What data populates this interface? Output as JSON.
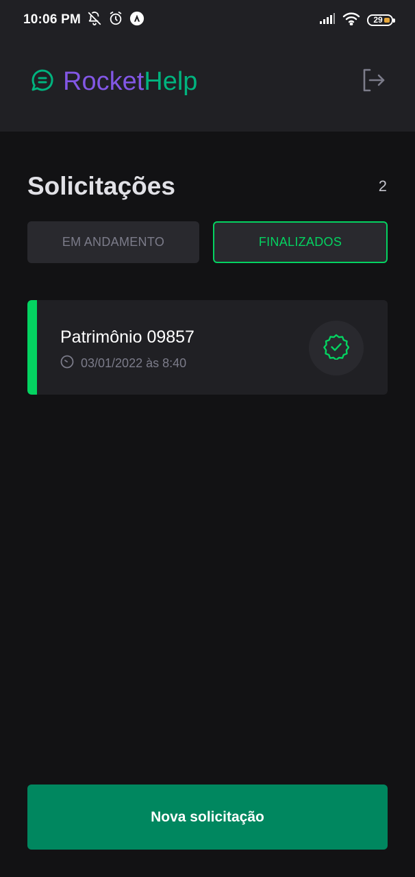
{
  "status_bar": {
    "time": "10:06 PM",
    "battery": "29",
    "icons": [
      "notifications-off-icon",
      "alarm-icon",
      "app-notification-icon",
      "signal-icon",
      "wifi-icon",
      "battery-icon"
    ]
  },
  "app": {
    "logo_part1": "Rocket",
    "logo_part2": "Help",
    "logo_icon": "chat-bubble-icon",
    "signout_icon": "sign-out-icon"
  },
  "main": {
    "title": "Solicitações",
    "count": "2",
    "filters": [
      {
        "label": "EM ANDAMENTO",
        "selected": false
      },
      {
        "label": "FINALIZADOS",
        "selected": true
      }
    ],
    "orders": [
      {
        "patrimony": "Patrimônio 09857",
        "when": "03/01/2022 às 8:40",
        "status": "closed",
        "status_icon": "check-badge-icon",
        "time_icon": "clock-icon"
      }
    ],
    "new_button": "Nova solicitação"
  },
  "colors": {
    "background": "#121214",
    "surface": "#202024",
    "rocket": "#8257e5",
    "help": "#00b37e",
    "closed_accent": "#04d361",
    "primary_button": "#00875f"
  }
}
